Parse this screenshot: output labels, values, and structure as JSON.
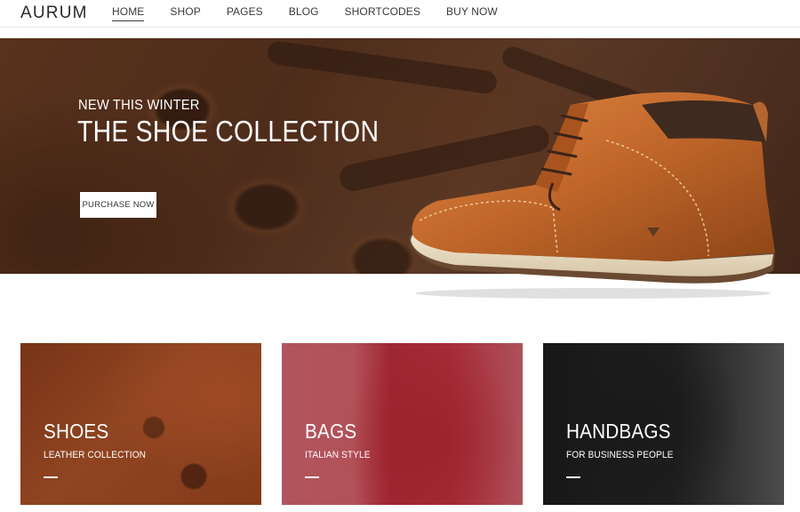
{
  "header": {
    "logo": "AURUM",
    "nav": [
      {
        "label": "HOME",
        "active": true
      },
      {
        "label": "SHOP",
        "active": false
      },
      {
        "label": "PAGES",
        "active": false
      },
      {
        "label": "BLOG",
        "active": false
      },
      {
        "label": "SHORTCODES",
        "active": false
      },
      {
        "label": "BUY NOW",
        "active": false
      }
    ]
  },
  "hero": {
    "subtitle": "NEW THIS WINTER",
    "title": "THE SHOE COLLECTION",
    "button_label": "PURCHASE NOW",
    "image": "brown-leather-boot"
  },
  "categories": [
    {
      "title": "SHOES",
      "subtitle": "LEATHER COLLECTION",
      "image": "shoe-laces-closeup"
    },
    {
      "title": "BAGS",
      "subtitle": "ITALIAN STYLE",
      "image": "red-backpack"
    },
    {
      "title": "HANDBAGS",
      "subtitle": "FOR BUSINESS PEOPLE",
      "image": "black-leather-briefcase"
    }
  ],
  "colors": {
    "hero_background": "#5a3320",
    "boot_leather": "#c0662a",
    "shoes_card": "#8c3e1c",
    "bags_card": "#a52633",
    "handbags_card": "#262626"
  }
}
